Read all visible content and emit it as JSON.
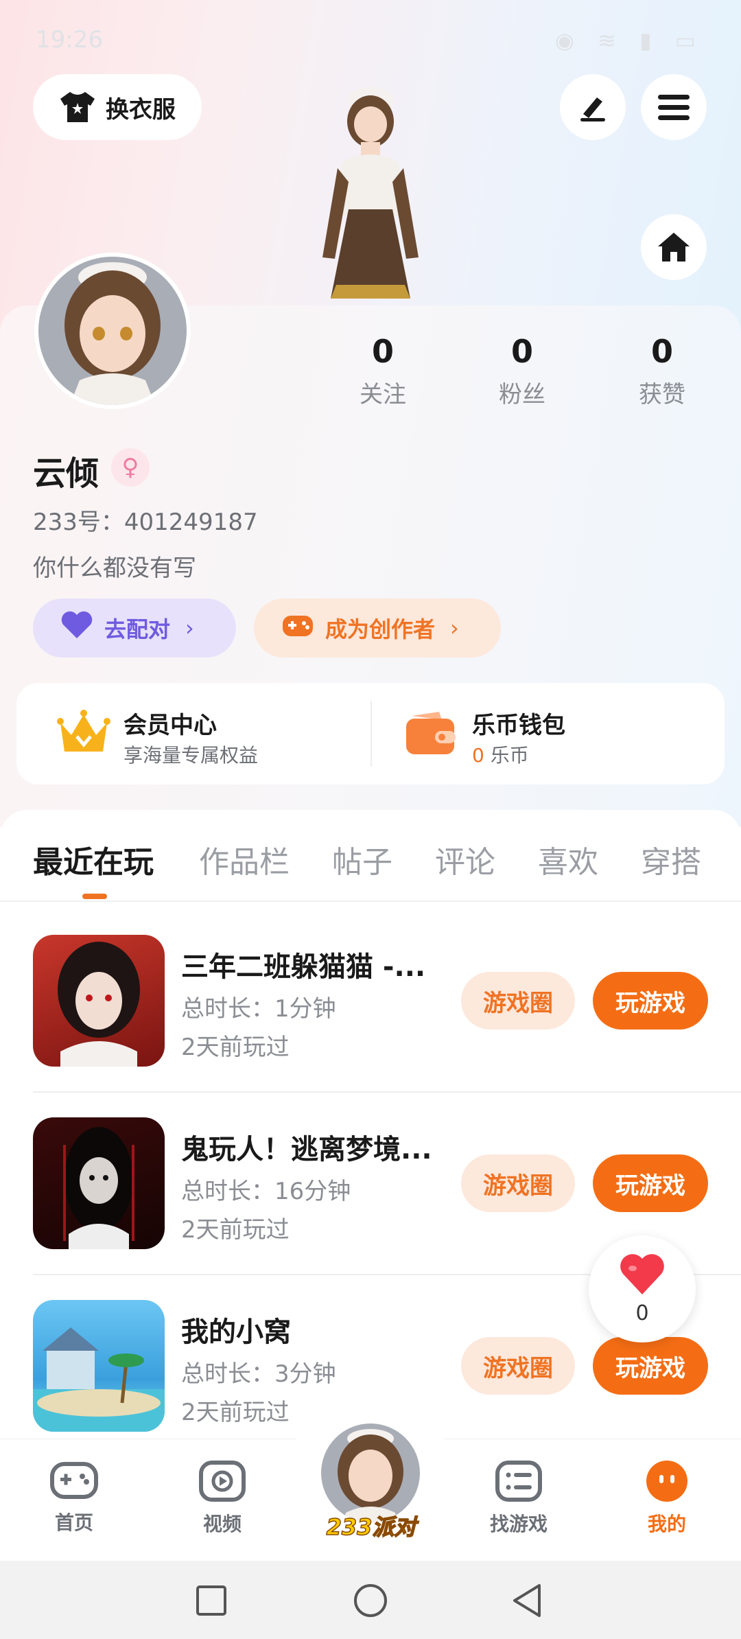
{
  "status_bar": {
    "time": "19:26",
    "icons": "◉ ≋ ▮ ▭"
  },
  "header": {
    "outfit_label": "换衣服"
  },
  "stats": [
    {
      "value": "0",
      "label": "关注"
    },
    {
      "value": "0",
      "label": "粉丝"
    },
    {
      "value": "0",
      "label": "获赞"
    }
  ],
  "profile": {
    "name": "云倾",
    "gender_symbol": "♀",
    "uid": "233号：401249187",
    "bio": "你什么都没有写"
  },
  "actions": {
    "match_label": "去配对",
    "creator_label": "成为创作者"
  },
  "vip": {
    "title": "会员中心",
    "subtitle": "享海量专属权益",
    "wallet_title": "乐币钱包",
    "wallet_amount": "0",
    "wallet_unit": "乐币"
  },
  "tabs": [
    "最近在玩",
    "作品栏",
    "帖子",
    "评论",
    "喜欢",
    "穿搭"
  ],
  "games": [
    {
      "name": "三年二班躲猫猫 -...",
      "duration": "总时长：1分钟",
      "last_played": "2天前玩过",
      "circle_label": "游戏圈",
      "play_label": "玩游戏"
    },
    {
      "name": "鬼玩人！逃离梦境...",
      "duration": "总时长：16分钟",
      "last_played": "2天前玩过",
      "circle_label": "游戏圈",
      "play_label": "玩游戏"
    },
    {
      "name": "我的小窝",
      "duration": "总时长：3分钟",
      "last_played": "2天前玩过",
      "circle_label": "游戏圈",
      "play_label": "玩游戏"
    }
  ],
  "like_count": "0",
  "bottom_nav": {
    "home": "首页",
    "video": "视频",
    "center": "233派对",
    "find": "找游戏",
    "mine": "我的"
  },
  "colors": {
    "accent": "#f46d14",
    "purple": "#6f5be0",
    "pink": "#f07aa0"
  }
}
